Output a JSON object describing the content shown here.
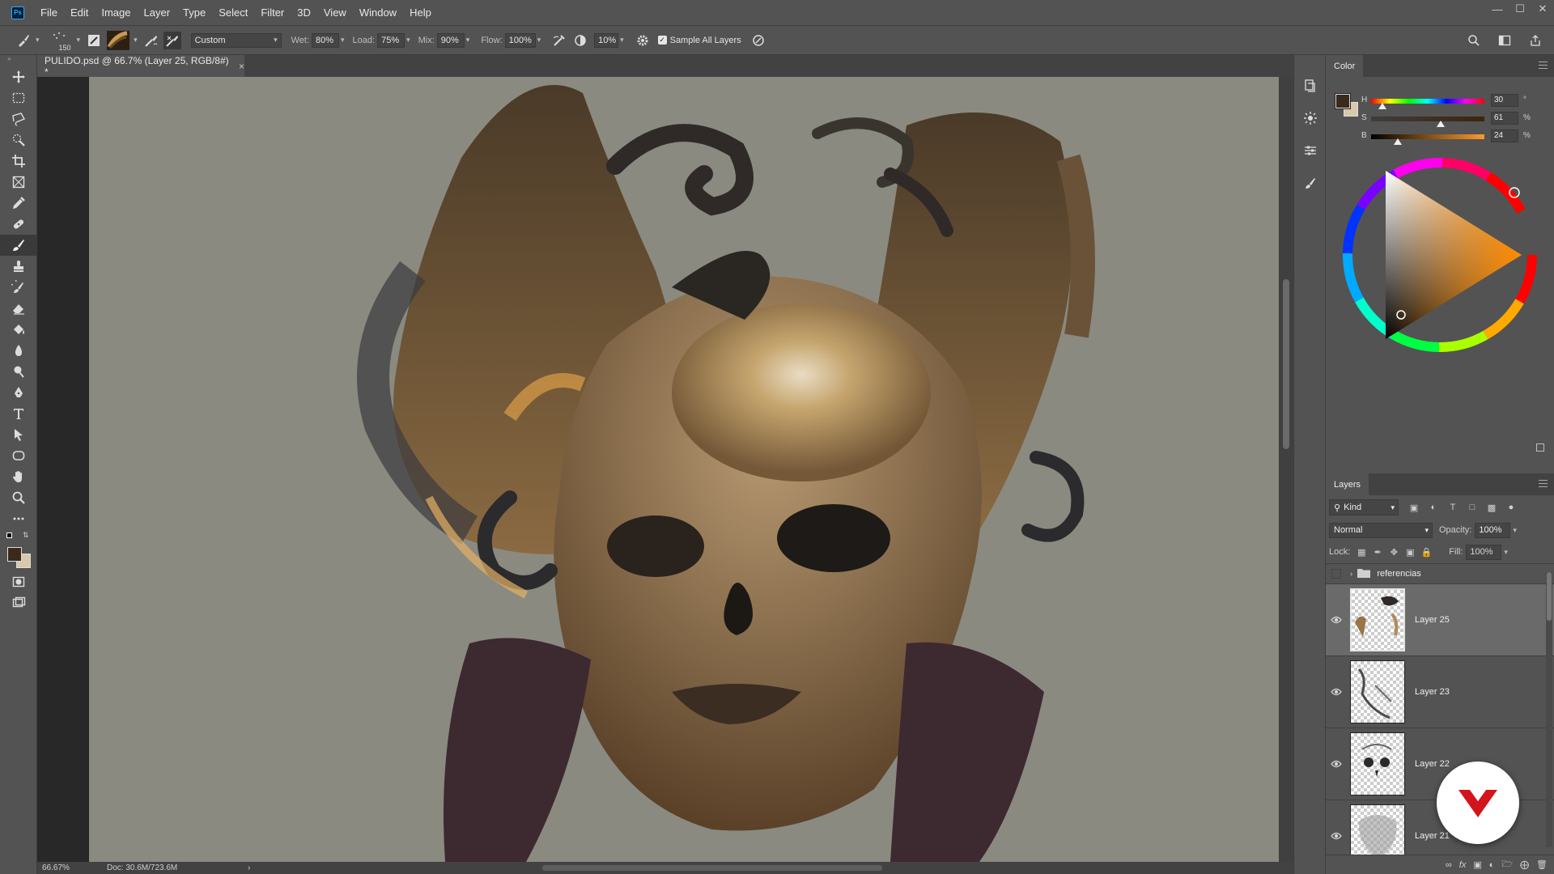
{
  "menubar": {
    "app_logo": "Ps",
    "items": [
      "File",
      "Edit",
      "Image",
      "Layer",
      "Type",
      "Select",
      "Filter",
      "3D",
      "View",
      "Window",
      "Help"
    ],
    "window_controls": [
      "minimize-icon",
      "restore-icon",
      "close-icon"
    ]
  },
  "options": {
    "brush_size": "150",
    "preset": "Custom",
    "wet_label": "Wet:",
    "wet_value": "80%",
    "load_label": "Load:",
    "load_value": "75%",
    "mix_label": "Mix:",
    "mix_value": "90%",
    "flow_label": "Flow:",
    "flow_value": "100%",
    "smoothing_value": "10%",
    "sample_all_layers": "Sample All Layers"
  },
  "document": {
    "tab_title": "PULIDO.psd @ 66.7% (Layer 25, RGB/8#) *",
    "close_glyph": "×",
    "zoom": "66.67%",
    "doc_size": "Doc: 30.6M/723.6M",
    "status_arrow": "›"
  },
  "color_panel": {
    "tab": "Color",
    "foreground_color": "#3b2a1c",
    "background_color": "#d9c8aa",
    "h_label": "H",
    "h_value": "30",
    "h_unit": "°",
    "s_label": "S",
    "s_value": "61",
    "s_unit": "%",
    "b_label": "B",
    "b_value": "24",
    "b_unit": "%"
  },
  "layers_panel": {
    "tab": "Layers",
    "kind_filter": "Kind",
    "blend_mode": "Normal",
    "opacity_label": "Opacity:",
    "opacity_value": "100%",
    "lock_label": "Lock:",
    "fill_label": "Fill:",
    "fill_value": "100%",
    "group_name": "referencias",
    "layers": [
      {
        "name": "Layer 25",
        "selected": true
      },
      {
        "name": "Layer 23",
        "selected": false
      },
      {
        "name": "Layer 22",
        "selected": false
      },
      {
        "name": "Layer 21",
        "selected": false
      }
    ]
  },
  "colors": {
    "ui_panel": "#535353",
    "ui_dark": "#424242",
    "canvas_background": "#8a8a80",
    "accent_blue": "#31a8ff",
    "badge_red": "#d4141c"
  }
}
